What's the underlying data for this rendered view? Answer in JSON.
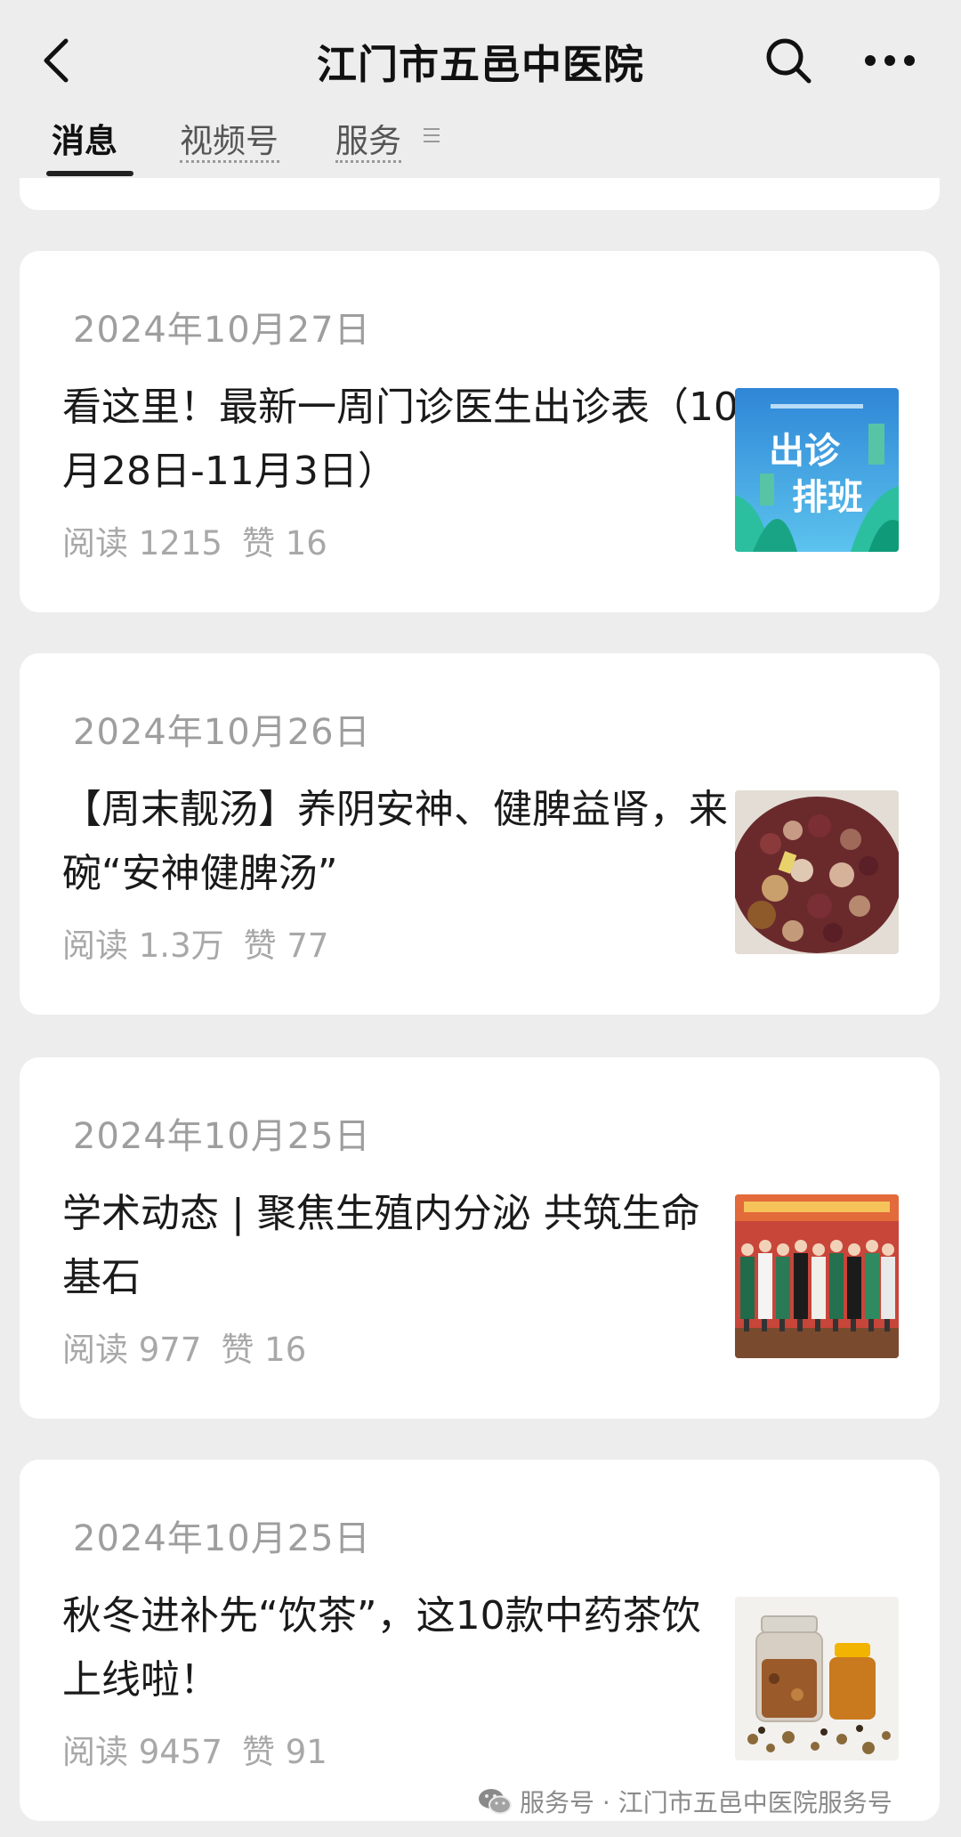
{
  "header": {
    "title": "江门市五邑中医院",
    "back_icon": "chevron-left-icon",
    "search_icon": "search-icon",
    "more_icon": "more-horizontal-icon"
  },
  "tabs": [
    {
      "label": "消息",
      "active": true
    },
    {
      "label": "视频号",
      "active": false
    },
    {
      "label": "服务",
      "active": false,
      "has_menu_icon": true
    }
  ],
  "articles": [
    {
      "date": "2024年10月27日",
      "headline": "看这里！最新一周门诊医生出诊表（10月28日-11月3日）",
      "read": "阅读 1215",
      "likes": "赞 16",
      "thumb_text_1": "出诊",
      "thumb_text_2": "排班",
      "thumb_colors": {
        "bg": "#3aa0e0",
        "accent": "#2bbfa0"
      }
    },
    {
      "date": "2024年10月26日",
      "headline": "【周末靓汤】养阴安神、健脾益肾，来碗“安神健脾汤”",
      "read": "阅读 1.3万",
      "likes": "赞 77"
    },
    {
      "date": "2024年10月25日",
      "headline": "学术动态 | 聚焦生殖内分泌 共筑生命基石",
      "read": "阅读 977",
      "likes": "赞 16"
    },
    {
      "date": "2024年10月25日",
      "headline": "秋冬进补先“饮茶”，这10款中药茶饮上线啦！",
      "read": "阅读 9457",
      "likes": "赞 91"
    }
  ],
  "watermark": {
    "icon": "wechat-icon",
    "text": "服务号 · 江门市五邑中医院服务号"
  },
  "colors": {
    "background": "#ededed",
    "card": "#ffffff",
    "meta_text": "#a8a8a8"
  }
}
